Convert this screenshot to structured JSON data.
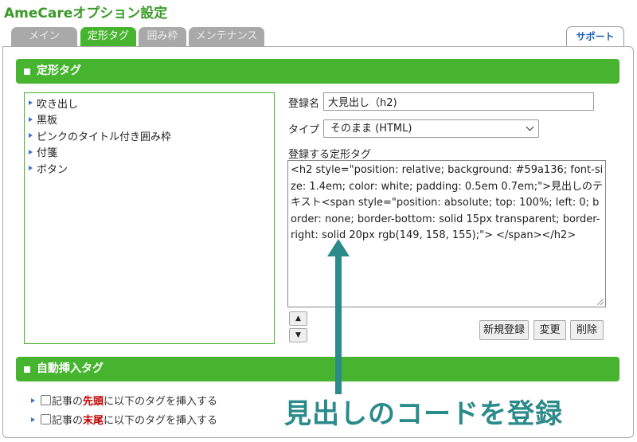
{
  "app": {
    "title": "AmeCareオプション設定"
  },
  "tabs": [
    {
      "label": "メイン",
      "active": false
    },
    {
      "label": "定形タグ",
      "active": true
    },
    {
      "label": "囲み枠",
      "active": false
    },
    {
      "label": "メンテナンス",
      "active": false
    }
  ],
  "support_tab": {
    "label": "サポート"
  },
  "sections": {
    "teikei": {
      "title": "定形タグ"
    },
    "auto": {
      "title": "自動挿入タグ"
    }
  },
  "tag_list": {
    "items": [
      "吹き出し",
      "黒板",
      "ピンクのタイトル付き囲み枠",
      "付箋",
      "ボタン"
    ]
  },
  "form": {
    "name_label": "登録名",
    "name_value": "大見出し（h2)",
    "type_label": "タイプ",
    "type_value": "そのまま (HTML)",
    "code_label": "登録する定形タグ",
    "code_value": "<h2 style=\"position: relative; background: #59a136; font-size: 1.4em; color: white; padding: 0.5em 0.7em;\">見出しのテキスト<span style=\"position: absolute; top: 100%; left: 0; border: none; border-bottom: solid 15px transparent; border-right: solid 20px rgb(149, 158, 155);\"> </span></h2>"
  },
  "buttons": {
    "up": "▲",
    "down": "▼",
    "new": "新規登録",
    "change": "変更",
    "delete": "削除"
  },
  "auto_insert": {
    "row1": {
      "prefix": "記事の",
      "highlight": "先頭",
      "suffix": "に以下のタグを挿入する",
      "checked": false
    },
    "row2": {
      "prefix": "記事の",
      "highlight": "末尾",
      "suffix": "に以下のタグを挿入する",
      "checked": false
    }
  },
  "annotation": {
    "caption": "見出しのコードを登録",
    "color": "#2b8a8a"
  },
  "colors": {
    "accent": "#46b42f",
    "title": "#3a9a28",
    "highlight": "#c00000",
    "link": "#1a5fb8"
  }
}
